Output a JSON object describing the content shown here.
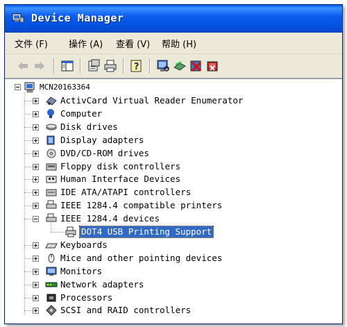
{
  "window": {
    "title": "Device Manager",
    "icon": "device-manager-icon"
  },
  "menu": [
    {
      "label": "文件",
      "accel": "(F)"
    },
    {
      "label": "操作",
      "accel": "(A)"
    },
    {
      "label": "查看",
      "accel": "(V)"
    },
    {
      "label": "帮助",
      "accel": "(H)"
    }
  ],
  "toolbar": {
    "buttons": [
      "back-icon",
      "forward-icon",
      "show-hide-tree-icon",
      "properties-icon",
      "print-icon",
      "help-icon",
      "scan-hardware-icon",
      "update-driver-icon",
      "disable-device-icon",
      "uninstall-device-icon"
    ]
  },
  "tree": {
    "root": "MCN20163364",
    "nodes": [
      {
        "label": "ActivCard Virtual Reader Enumerator",
        "expanded": false
      },
      {
        "label": "Computer",
        "expanded": false
      },
      {
        "label": "Disk drives",
        "expanded": false
      },
      {
        "label": "Display adapters",
        "expanded": false
      },
      {
        "label": "DVD/CD-ROM drives",
        "expanded": false
      },
      {
        "label": "Floppy disk controllers",
        "expanded": false
      },
      {
        "label": "Human Interface Devices",
        "expanded": false
      },
      {
        "label": "IDE ATA/ATAPI controllers",
        "expanded": false
      },
      {
        "label": "IEEE 1284.4 compatible printers",
        "expanded": false
      },
      {
        "label": "IEEE 1284.4 devices",
        "expanded": true,
        "children": [
          "DOT4 USB Printing Support"
        ]
      },
      {
        "label": "Keyboards",
        "expanded": false
      },
      {
        "label": "Mice and other pointing devices",
        "expanded": false
      },
      {
        "label": "Monitors",
        "expanded": false
      },
      {
        "label": "Network adapters",
        "expanded": false
      },
      {
        "label": "Processors",
        "expanded": false
      },
      {
        "label": "SCSI and RAID controllers",
        "expanded": false
      }
    ],
    "selected": "DOT4 USB Printing Support"
  },
  "colors": {
    "titlebar": "#0554e3",
    "selection": "#316ac5"
  }
}
